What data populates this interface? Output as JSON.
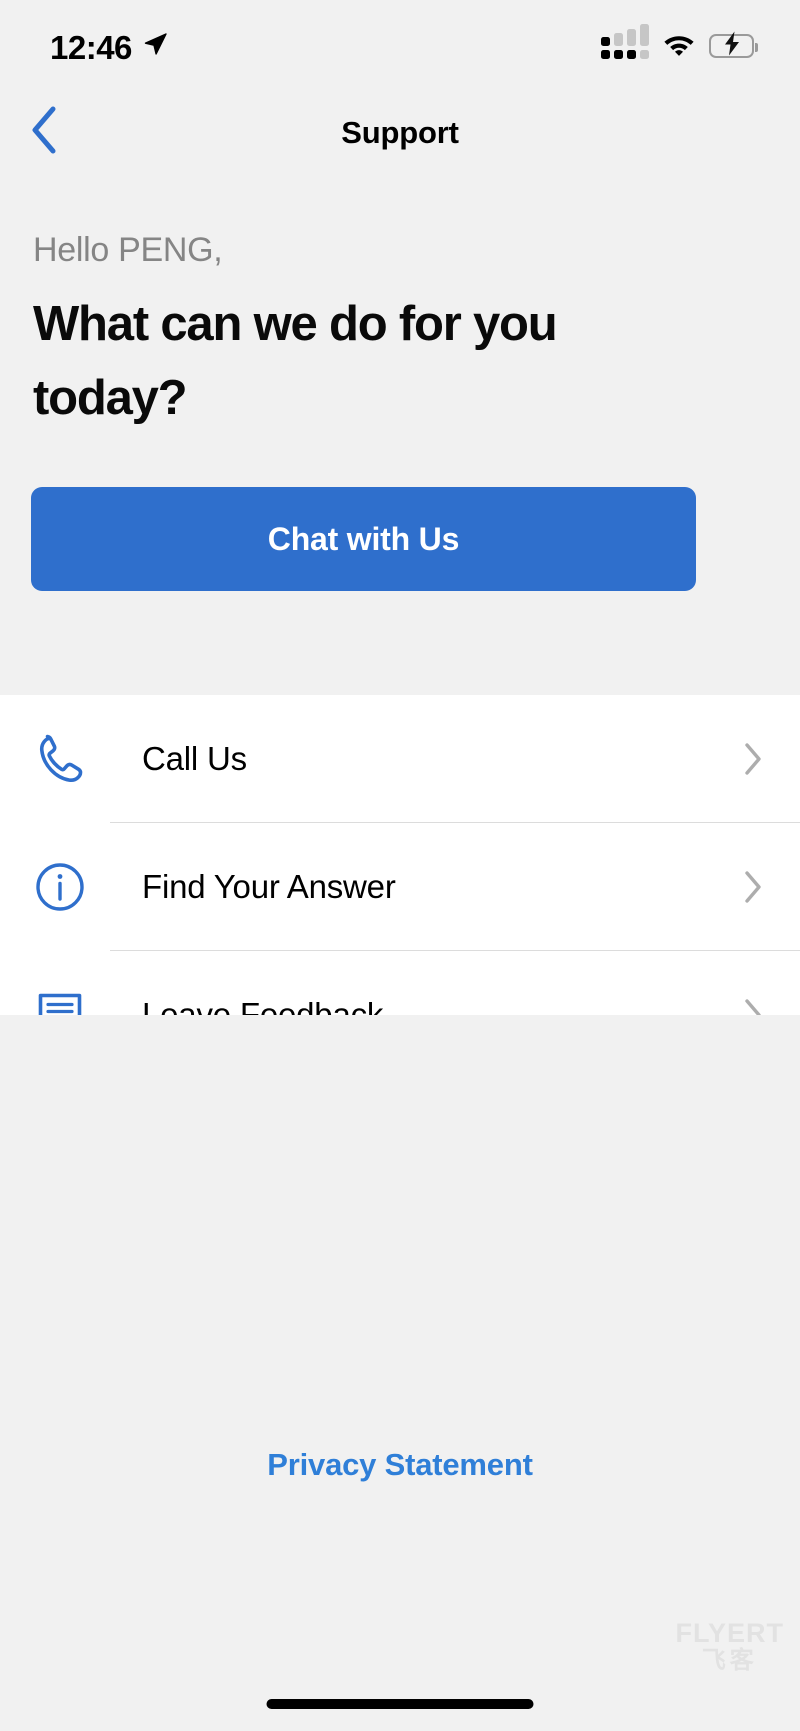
{
  "status_bar": {
    "time": "12:46",
    "location_icon": "location-arrow-icon",
    "cellular_icon": "cellular-signal-icon",
    "wifi_icon": "wifi-icon",
    "battery_icon": "battery-charging-icon",
    "battery_color": "#4cd455"
  },
  "nav": {
    "back_icon": "chevron-left-icon",
    "title": "Support",
    "accent_color": "#2f6fcc"
  },
  "hero": {
    "greeting": "Hello PENG,",
    "headline": "What can we do for you today?",
    "cta_label": "Chat with Us",
    "cta_color": "#2f6fcc"
  },
  "list": {
    "items": [
      {
        "label": "Call Us",
        "icon": "phone-icon",
        "chevron": "chevron-right-icon"
      },
      {
        "label": "Find Your Answer",
        "icon": "info-circle-icon",
        "chevron": "chevron-right-icon"
      },
      {
        "label": "Leave Feedback",
        "icon": "feedback-bubble-icon",
        "chevron": "chevron-right-icon"
      }
    ]
  },
  "footer": {
    "privacy_label": "Privacy Statement",
    "privacy_color": "#2f7fd8",
    "watermark_main": "FLYERT",
    "watermark_sub": "飞客"
  }
}
